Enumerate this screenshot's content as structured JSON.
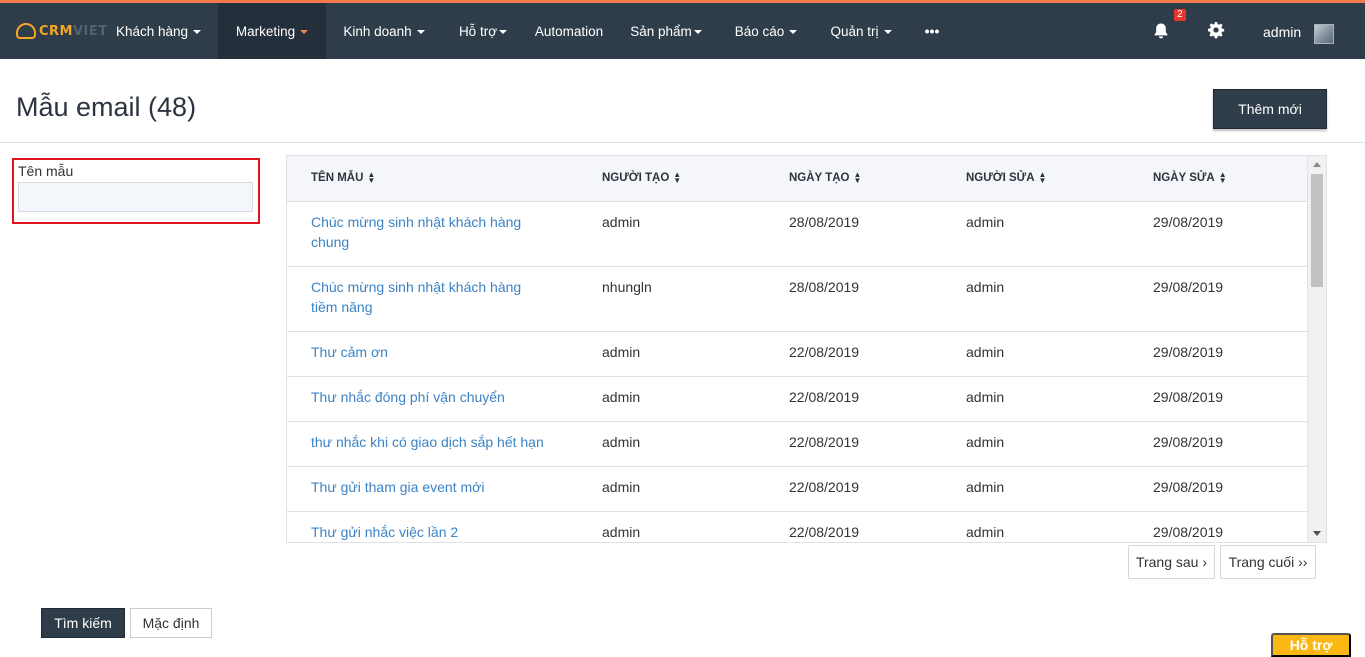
{
  "nav": {
    "logo": {
      "part1": "CRM",
      "part2": "VIET"
    },
    "items": [
      {
        "label": "Khách hàng",
        "dropdown": true,
        "active": false
      },
      {
        "label": "Marketing",
        "dropdown": true,
        "active": true
      },
      {
        "label": "Kinh doanh",
        "dropdown": true,
        "active": false
      },
      {
        "label": "Hỗ trợ",
        "dropdown": true,
        "active": false
      },
      {
        "label": "Automation",
        "dropdown": false,
        "active": false
      },
      {
        "label": "Sản phẩm",
        "dropdown": true,
        "active": false
      },
      {
        "label": "Báo cáo",
        "dropdown": true,
        "active": false
      },
      {
        "label": "Quản trị",
        "dropdown": true,
        "active": false
      },
      {
        "label": "•••",
        "dropdown": false,
        "active": false
      }
    ],
    "notification_count": "2",
    "user": "admin",
    "icons": {
      "notifications": "bell-icon",
      "settings": "gear-icon",
      "avatar": "user-avatar"
    }
  },
  "header": {
    "title": "Mẫu email (48)",
    "add_button": "Thêm mới"
  },
  "filter": {
    "label": "Tên mẫu",
    "value": "",
    "placeholder": "",
    "search_button": "Tìm kiếm",
    "default_button": "Mặc định"
  },
  "table": {
    "columns": [
      "TÊN MẪU",
      "NGƯỜI TẠO",
      "NGÀY TẠO",
      "NGƯỜI SỬA",
      "NGÀY SỬA"
    ],
    "rows": [
      {
        "name": "Chúc mừng sinh nhật khách hàng chung",
        "creator": "admin",
        "created": "28/08/2019",
        "editor": "admin",
        "edited": "29/08/2019"
      },
      {
        "name": "Chúc mừng sinh nhật khách hàng tiềm năng",
        "creator": "nhungln",
        "created": "28/08/2019",
        "editor": "admin",
        "edited": "29/08/2019"
      },
      {
        "name": "Thư cảm ơn",
        "creator": "admin",
        "created": "22/08/2019",
        "editor": "admin",
        "edited": "29/08/2019"
      },
      {
        "name": "Thư nhắc đóng phí vận chuyển",
        "creator": "admin",
        "created": "22/08/2019",
        "editor": "admin",
        "edited": "29/08/2019"
      },
      {
        "name": "thư nhắc khi có giao dịch sắp hết hạn",
        "creator": "admin",
        "created": "22/08/2019",
        "editor": "admin",
        "edited": "29/08/2019"
      },
      {
        "name": "Thư gửi tham gia event mới",
        "creator": "admin",
        "created": "22/08/2019",
        "editor": "admin",
        "edited": "29/08/2019"
      },
      {
        "name": "Thư gửi nhắc việc lần 2",
        "creator": "admin",
        "created": "22/08/2019",
        "editor": "admin",
        "edited": "29/08/2019"
      }
    ]
  },
  "pagination": {
    "next": "Trang sau ›",
    "last": "Trang cuối ››"
  },
  "help_button": "Hỗ trợ",
  "colors": {
    "navbar": "#2f3d4b",
    "accent": "#f47b4f",
    "link": "#3b83c4",
    "help": "#fbb814",
    "highlight_border": "#e1121a"
  }
}
